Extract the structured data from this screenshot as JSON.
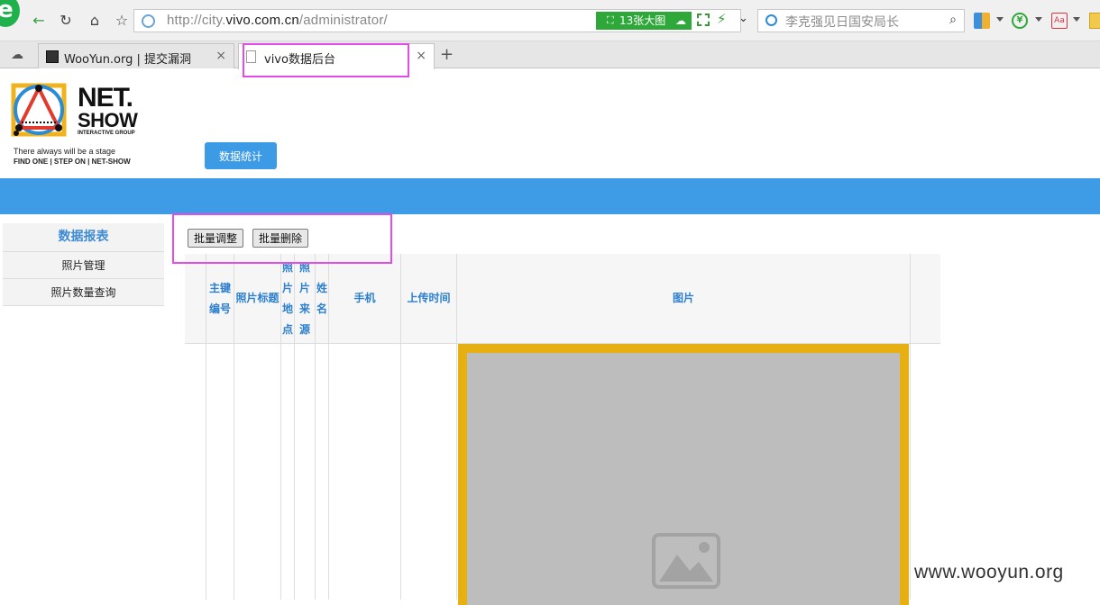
{
  "browser": {
    "url_scheme": "http://city.",
    "url_host": "vivo.com.cn",
    "url_path": "/administrator/",
    "image_badge": "13张大图",
    "search_placeholder": "李克强见日国安局长",
    "tabs": [
      {
        "title": "WooYun.org | 提交漏洞",
        "active": false
      },
      {
        "title": "vivo数据后台",
        "active": true
      }
    ]
  },
  "brand": {
    "name_line1": "NET.",
    "name_line2": "SHOW",
    "sub": "INTERACTIVE GROUP",
    "tagline1": "There always will be a stage",
    "tagline2": "FIND ONE | STEP ON | NET-SHOW"
  },
  "header": {
    "stat_button": "数据统计"
  },
  "sidebar": {
    "heading": "数据报表",
    "items": [
      {
        "label": "照片管理"
      },
      {
        "label": "照片数量查询"
      }
    ]
  },
  "actions": {
    "batch_adjust": "批量调整",
    "batch_delete": "批量删除"
  },
  "table": {
    "columns": [
      "主键编号",
      "照片标题",
      "照片地点",
      "照片来源",
      "姓名",
      "手机",
      "上传时间",
      "图片"
    ]
  },
  "colors": {
    "accent": "#3e9be6",
    "highlight": "#e14de6",
    "frame": "#e6b012"
  },
  "watermark": "www.wooyun.org"
}
